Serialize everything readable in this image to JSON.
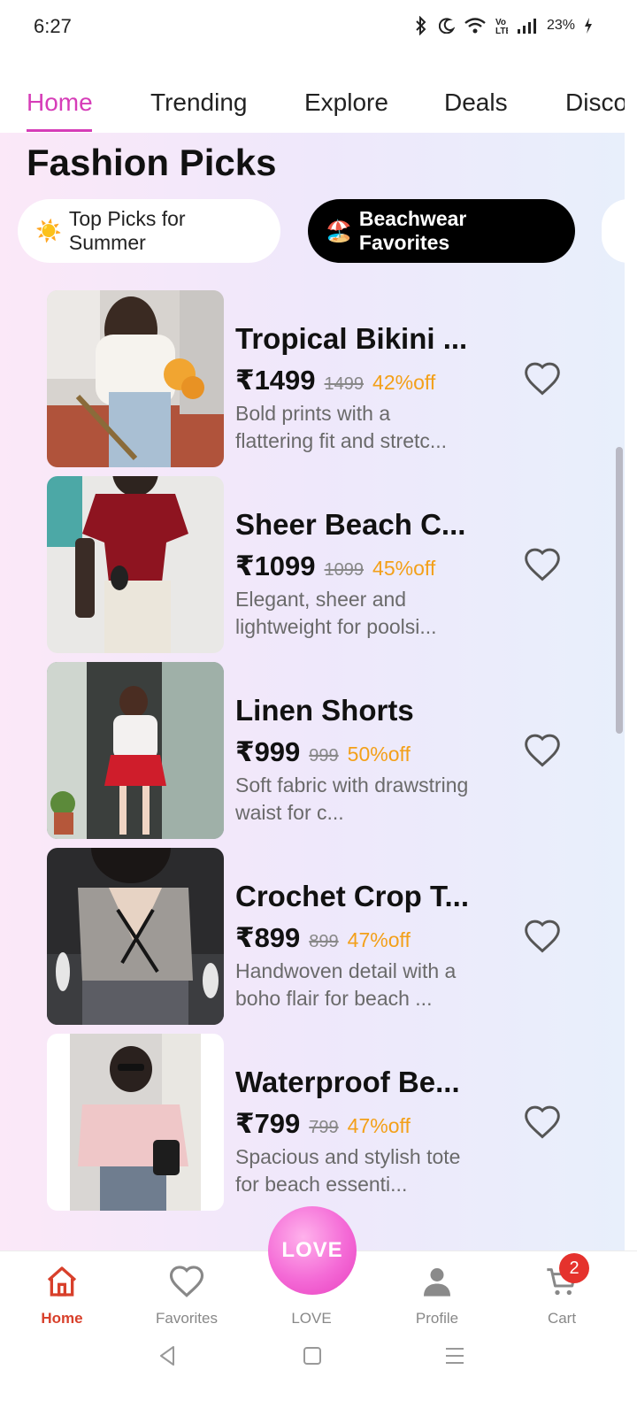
{
  "status_bar": {
    "time": "6:27",
    "battery": "23%",
    "icons": [
      "bluetooth-icon",
      "moon-icon",
      "wifi-icon",
      "volte-icon",
      "signal-icon",
      "charging-icon"
    ]
  },
  "tabs": [
    {
      "label": "Home",
      "active": true
    },
    {
      "label": "Trending",
      "active": false
    },
    {
      "label": "Explore",
      "active": false
    },
    {
      "label": "Deals",
      "active": false
    },
    {
      "label": "Disco",
      "active": false
    }
  ],
  "section": {
    "title": "Fashion Picks",
    "chips": [
      {
        "emoji": "☀️",
        "label": "Top Picks for Summer",
        "selected": false
      },
      {
        "emoji": "🏖️",
        "label": "Beachwear Favorites",
        "selected": true
      }
    ]
  },
  "products": [
    {
      "name": "Tropical Bikini ...",
      "price": "₹1499",
      "mrp": "1499",
      "off": "42%off",
      "desc": "Bold prints with a flattering fit and stretc..."
    },
    {
      "name": "Sheer Beach C...",
      "price": "₹1099",
      "mrp": "1099",
      "off": "45%off",
      "desc": "Elegant, sheer and lightweight for poolsi..."
    },
    {
      "name": "Linen Shorts",
      "price": "₹999",
      "mrp": "999",
      "off": "50%off",
      "desc": "Soft fabric with drawstring waist for c..."
    },
    {
      "name": "Crochet Crop T...",
      "price": "₹899",
      "mrp": "899",
      "off": "47%off",
      "desc": "Handwoven detail with a boho flair for beach ..."
    },
    {
      "name": "Waterproof Be...",
      "price": "₹799",
      "mrp": "799",
      "off": "47%off",
      "desc": "Spacious and stylish tote for beach essenti..."
    }
  ],
  "bottom_nav": {
    "home": "Home",
    "favorites": "Favorites",
    "love_button": "LOVE",
    "love": "LOVE",
    "profile": "Profile",
    "cart": "Cart",
    "cart_count": "2"
  },
  "colors": {
    "accent": "#d63db8",
    "discount": "#f3a019",
    "active_nav": "#d8402b",
    "badge": "#e5322d"
  }
}
